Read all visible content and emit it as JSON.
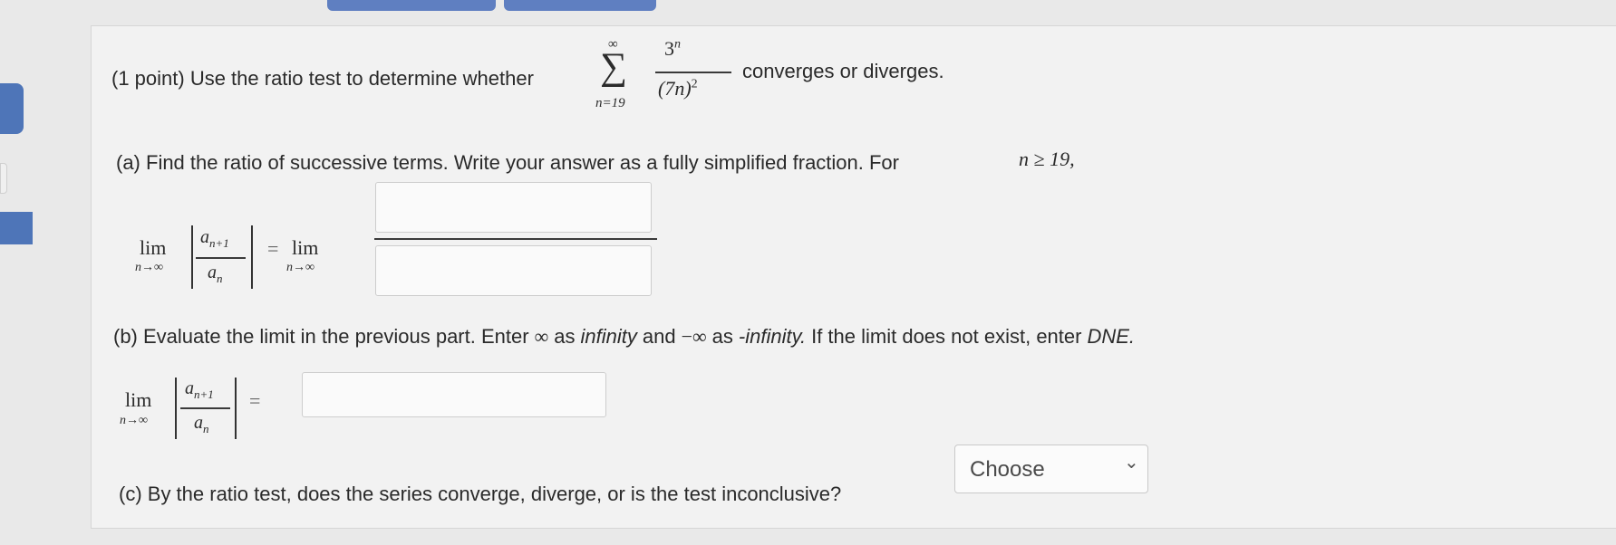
{
  "question": {
    "intro_prefix": "(1 point) Use the ratio test to determine whether",
    "sigma": "∑",
    "sum_upper": "∞",
    "sum_lower": "n=19",
    "term_numerator_base": "3",
    "term_numerator_exp": "n",
    "term_denominator_base": "(7n)",
    "term_denominator_exp": "2",
    "intro_suffix": "converges or diverges."
  },
  "part_a": {
    "text": "(a) Find the ratio of successive terms. Write your answer as a fully simplified fraction. For",
    "condition": "n ≥ 19,",
    "lim_word": "lim",
    "lim_sub": "n→∞",
    "ratio_num": "a",
    "ratio_num_sub": "n+1",
    "ratio_den": "a",
    "ratio_den_sub": "n",
    "equals": "=",
    "numerator_value": "",
    "denominator_value": ""
  },
  "part_b": {
    "text_1": "(b) Evaluate the limit in the previous part. Enter",
    "inf_symbol": "∞",
    "text_as": "as",
    "infinity_word": "infinity",
    "text_and": "and",
    "neg_inf_symbol": "−∞",
    "text_as_2": "as",
    "neg_infinity_word": "-infinity.",
    "text_2": "If the limit does not exist, enter",
    "dne_word": "DNE.",
    "answer_value": ""
  },
  "part_c": {
    "text": "(c) By the ratio test, does the series converge, diverge, or is the test inconclusive?",
    "select_value": "Choose",
    "chevron": "⌄"
  }
}
